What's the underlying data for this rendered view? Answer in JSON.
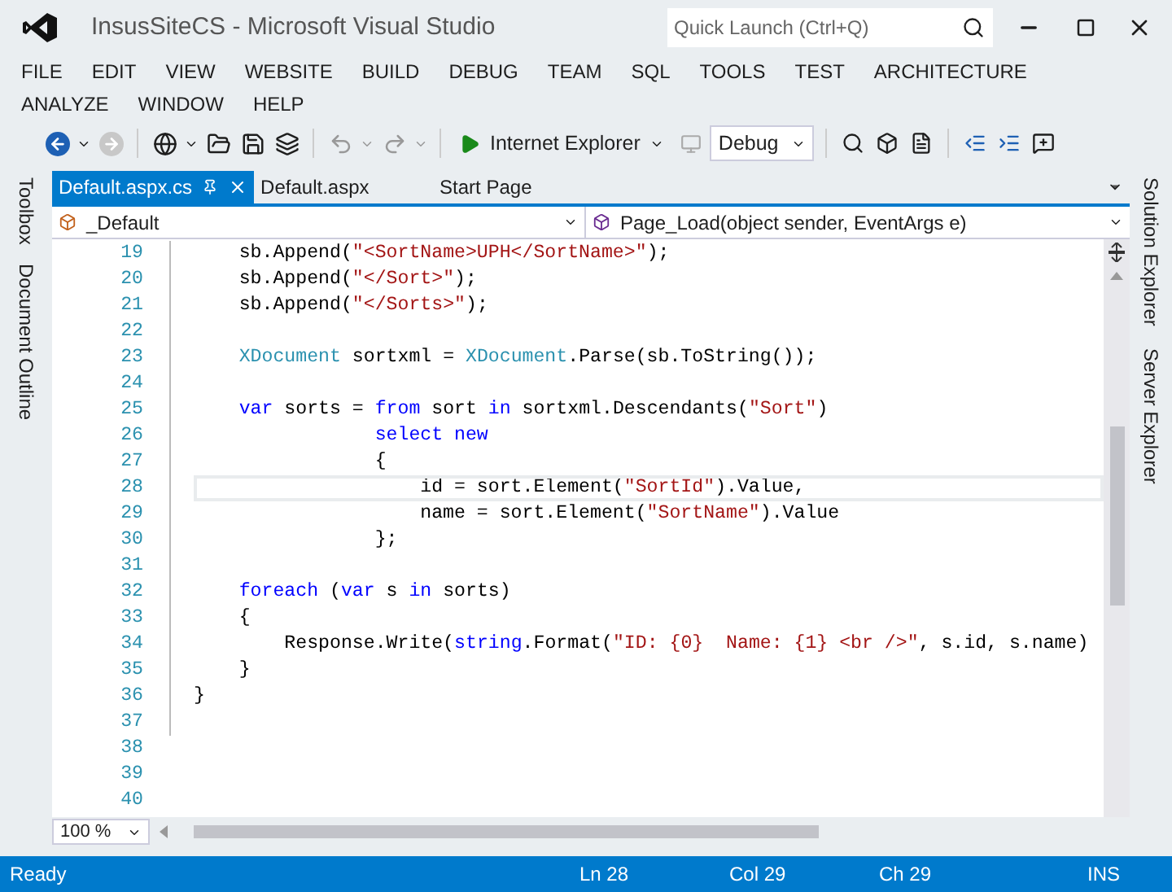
{
  "window": {
    "title": "InsusSiteCS - Microsoft Visual Studio"
  },
  "quick_launch": {
    "placeholder": "Quick Launch (Ctrl+Q)"
  },
  "menu": [
    "FILE",
    "EDIT",
    "VIEW",
    "WEBSITE",
    "BUILD",
    "DEBUG",
    "TEAM",
    "SQL",
    "TOOLS",
    "TEST",
    "ARCHITECTURE",
    "ANALYZE",
    "WINDOW",
    "HELP"
  ],
  "toolbar": {
    "browser": "Internet Explorer",
    "configuration": "Debug"
  },
  "left_panels": [
    "Toolbox",
    "Document Outline"
  ],
  "right_panels": [
    "Solution Explorer",
    "Server Explorer"
  ],
  "tabs": [
    {
      "label": "Default.aspx.cs",
      "selected": true
    },
    {
      "label": "Default.aspx",
      "selected": false
    },
    {
      "label": "Start Page",
      "selected": false
    }
  ],
  "navigation": {
    "class": "_Default",
    "member": "Page_Load(object sender, EventArgs e)"
  },
  "code_lines": [
    {
      "number": "19",
      "current": false,
      "tokens": [
        {
          "kind": "plain",
          "text": "    sb.Append("
        },
        {
          "kind": "string",
          "text": "\"<SortName>UPH</SortName>\""
        },
        {
          "kind": "plain",
          "text": ");"
        }
      ]
    },
    {
      "number": "20",
      "current": false,
      "tokens": [
        {
          "kind": "plain",
          "text": "    sb.Append("
        },
        {
          "kind": "string",
          "text": "\"</Sort>\""
        },
        {
          "kind": "plain",
          "text": ");"
        }
      ]
    },
    {
      "number": "21",
      "current": false,
      "tokens": [
        {
          "kind": "plain",
          "text": "    sb.Append("
        },
        {
          "kind": "string",
          "text": "\"</Sorts>\""
        },
        {
          "kind": "plain",
          "text": ");"
        }
      ]
    },
    {
      "number": "22",
      "current": false
    },
    {
      "number": "23",
      "current": false,
      "tokens": [
        {
          "kind": "type",
          "text": "    XDocument"
        },
        {
          "kind": "plain",
          "text": " sortxml = "
        },
        {
          "kind": "type",
          "text": "XDocument"
        },
        {
          "kind": "plain",
          "text": ".Parse(sb.ToString());"
        }
      ]
    },
    {
      "number": "24",
      "current": false
    },
    {
      "number": "25",
      "current": false,
      "tokens": [
        {
          "kind": "keyword",
          "text": "    var"
        },
        {
          "kind": "plain",
          "text": " sorts = "
        },
        {
          "kind": "keyword",
          "text": "from"
        },
        {
          "kind": "plain",
          "text": " sort "
        },
        {
          "kind": "keyword",
          "text": "in"
        },
        {
          "kind": "plain",
          "text": " sortxml.Descendants("
        },
        {
          "kind": "string",
          "text": "\"Sort\""
        },
        {
          "kind": "plain",
          "text": ")"
        }
      ]
    },
    {
      "number": "26",
      "current": false,
      "tokens": [
        {
          "kind": "keyword",
          "text": "                select new"
        }
      ]
    },
    {
      "number": "27",
      "current": false,
      "tokens": [
        {
          "kind": "plain",
          "text": "                {"
        }
      ]
    },
    {
      "number": "28",
      "current": true,
      "tokens": [
        {
          "kind": "plain",
          "text": "                    id = sort.Element("
        },
        {
          "kind": "string",
          "text": "\"SortId\""
        },
        {
          "kind": "plain",
          "text": ").Value,"
        }
      ]
    },
    {
      "number": "29",
      "current": false,
      "tokens": [
        {
          "kind": "plain",
          "text": "                    name = sort.Element("
        },
        {
          "kind": "string",
          "text": "\"SortName\""
        },
        {
          "kind": "plain",
          "text": ").Value"
        }
      ]
    },
    {
      "number": "30",
      "current": false,
      "tokens": [
        {
          "kind": "plain",
          "text": "                };"
        }
      ]
    },
    {
      "number": "31",
      "current": false
    },
    {
      "number": "32",
      "current": false,
      "tokens": [
        {
          "kind": "keyword",
          "text": "    foreach"
        },
        {
          "kind": "plain",
          "text": " ("
        },
        {
          "kind": "keyword",
          "text": "var"
        },
        {
          "kind": "plain",
          "text": " s "
        },
        {
          "kind": "keyword",
          "text": "in"
        },
        {
          "kind": "plain",
          "text": " sorts)"
        }
      ]
    },
    {
      "number": "33",
      "current": false,
      "tokens": [
        {
          "kind": "plain",
          "text": "    {"
        }
      ]
    },
    {
      "number": "34",
      "current": false,
      "tokens": [
        {
          "kind": "plain",
          "text": "        Response.Write("
        },
        {
          "kind": "keyword",
          "text": "string"
        },
        {
          "kind": "plain",
          "text": ".Format("
        },
        {
          "kind": "string",
          "text": "\"ID: {0}  Name: {1} <br />\""
        },
        {
          "kind": "plain",
          "text": ", s.id, s.name)"
        }
      ]
    },
    {
      "number": "35",
      "current": false,
      "tokens": [
        {
          "kind": "plain",
          "text": "    }"
        }
      ]
    },
    {
      "number": "36",
      "current": false,
      "tokens": [
        {
          "kind": "plain",
          "text": "}"
        }
      ]
    },
    {
      "number": "37",
      "current": false
    },
    {
      "number": "38",
      "current": false
    },
    {
      "number": "39",
      "current": false
    },
    {
      "number": "40",
      "current": false
    }
  ],
  "zoom": "100 %",
  "status_bar": {
    "message": "Ready",
    "line": "Ln 28",
    "column": "Col 29",
    "char": "Ch 29",
    "mode": "INS"
  }
}
